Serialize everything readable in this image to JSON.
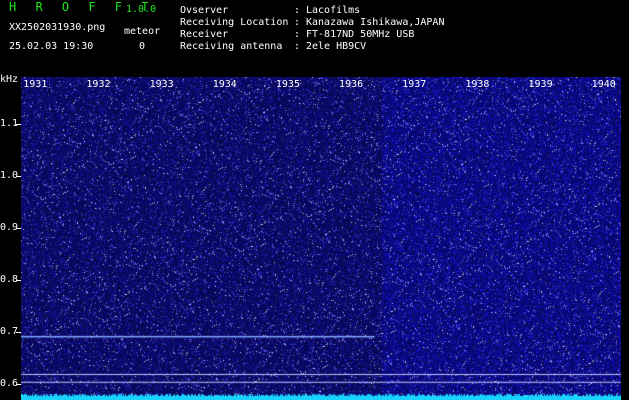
{
  "header": {
    "title": "H R O F F T",
    "version": "1.0.0",
    "filename": "XX2502031930.png",
    "meteor_label": "meteor",
    "datetime": "25.02.03 19:30",
    "meteor_count": "0",
    "info": [
      {
        "key": "Ovserver",
        "sep": ":",
        "value": "Lacofilms"
      },
      {
        "key": "Receiving Location",
        "sep": ":",
        "value": "Kanazawa Ishikawa,JAPAN"
      },
      {
        "key": "Receiver",
        "sep": ":",
        "value": "FT-817ND 50MHz USB"
      },
      {
        "key": "Receiving antenna",
        "sep": ":",
        "value": "2ele HB9CV"
      }
    ]
  },
  "colors": {
    "background": "#000000",
    "title_green": "#1ee61e",
    "spectrogram_base": "#0a0a6e",
    "noise_floor": "#19d3ff",
    "reference_line": "#c8c8ff"
  },
  "chart_data": {
    "type": "heatmap",
    "x_label_unit": "",
    "y_unit_label": "kHz",
    "x_ticks": [
      "1931",
      "1932",
      "1933",
      "1934",
      "1935",
      "1936",
      "1937",
      "1938",
      "1939",
      "1940"
    ],
    "y_ticks": [
      "1.1",
      "1.0",
      "0.9",
      "0.8",
      "0.7",
      "0.6"
    ],
    "ylim": [
      0.57,
      1.19
    ],
    "xlim": [
      1930.6,
      1940.1
    ],
    "features": [
      {
        "name": "horizontal carrier",
        "y": 0.693,
        "x_range": [
          1930.6,
          1936.2
        ]
      },
      {
        "name": "reference line",
        "y": 0.62
      },
      {
        "name": "reference line",
        "y": 0.605
      }
    ],
    "brightness_step_at_x": 1936.3
  }
}
